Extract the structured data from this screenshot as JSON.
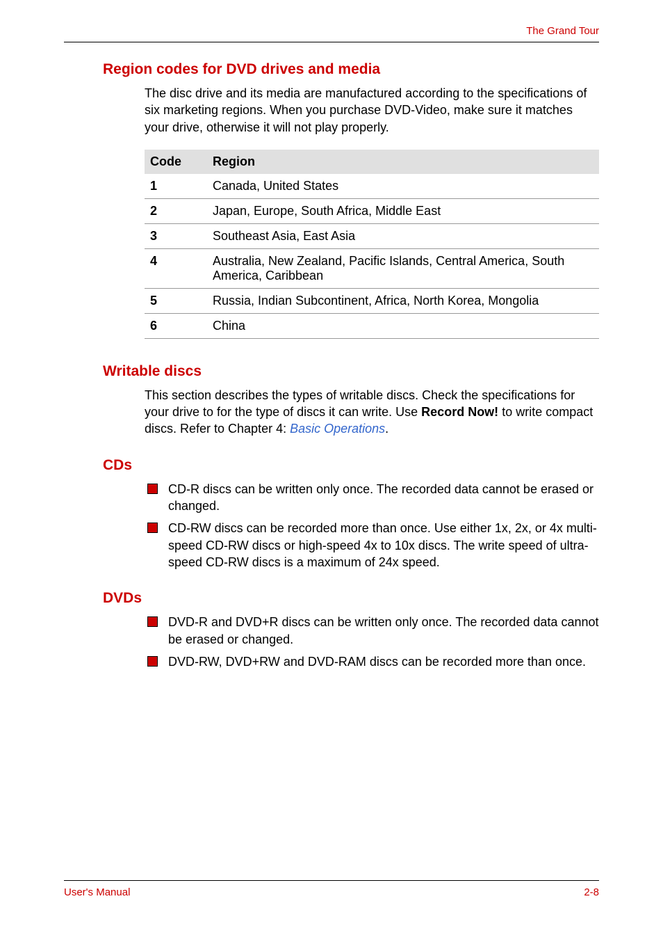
{
  "header": {
    "title": "The Grand Tour"
  },
  "sections": {
    "regionCodes": {
      "heading": "Region codes for DVD drives and media",
      "intro": "The disc drive and its media are manufactured according to the specifications of six marketing regions. When you purchase DVD-Video, make sure it matches your drive, otherwise it will not play properly."
    },
    "table": {
      "headers": {
        "code": "Code",
        "region": "Region"
      },
      "rows": [
        {
          "code": "1",
          "region": "Canada, United States"
        },
        {
          "code": "2",
          "region": "Japan, Europe, South Africa, Middle East"
        },
        {
          "code": "3",
          "region": "Southeast Asia, East Asia"
        },
        {
          "code": "4",
          "region": "Australia, New Zealand, Pacific Islands, Central America, South America, Caribbean"
        },
        {
          "code": "5",
          "region": "Russia, Indian Subcontinent, Africa, North Korea, Mongolia"
        },
        {
          "code": "6",
          "region": "China"
        }
      ]
    },
    "writableDiscs": {
      "heading": "Writable discs",
      "intro_part1": "This section describes the types of writable discs. Check the specifications for your drive to for the type of discs it can write. Use ",
      "intro_bold": "Record Now!",
      "intro_part2": " to write compact discs. Refer to Chapter 4: ",
      "intro_link": "Basic Operations",
      "intro_part3": "."
    },
    "cds": {
      "heading": "CDs",
      "items": [
        "CD-R discs can be written only once. The recorded data cannot be erased or changed.",
        "CD-RW discs can be recorded more than once. Use either 1x, 2x, or 4x multi-speed CD-RW discs or high-speed 4x to 10x discs. The write speed of ultra-speed CD-RW discs is a maximum of 24x speed."
      ]
    },
    "dvds": {
      "heading": "DVDs",
      "items": [
        "DVD-R and DVD+R discs can be written only once. The recorded data cannot be erased or changed.",
        "DVD-RW, DVD+RW and DVD-RAM discs can be recorded more than once."
      ]
    }
  },
  "footer": {
    "left": "User's Manual",
    "right": "2-8"
  }
}
